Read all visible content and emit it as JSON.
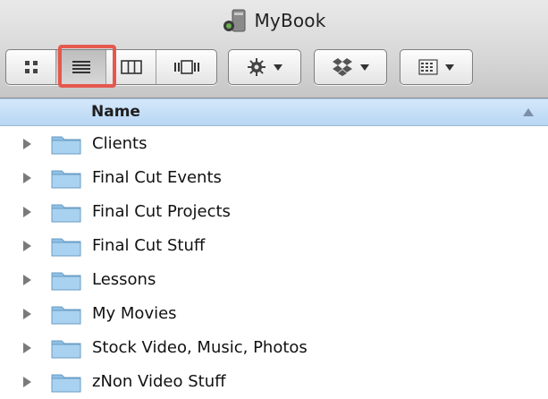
{
  "window": {
    "title": "MyBook",
    "title_icon": "external-drive-icon"
  },
  "toolbar": {
    "view_modes": [
      {
        "name": "icon-view",
        "icon": "grid-icon",
        "selected": false
      },
      {
        "name": "list-view",
        "icon": "list-icon",
        "selected": true
      },
      {
        "name": "column-view",
        "icon": "columns-icon",
        "selected": false
      },
      {
        "name": "cover-flow-view",
        "icon": "cover-flow-icon",
        "selected": false
      }
    ],
    "action_menu": {
      "icon": "gear-icon"
    },
    "dropbox_menu": {
      "icon": "dropbox-icon"
    },
    "arrange_menu": {
      "icon": "arrange-grid-icon"
    },
    "highlight_color": "#e5584e"
  },
  "list": {
    "column_header": "Name",
    "items": [
      {
        "name": "Clients"
      },
      {
        "name": "Final Cut Events"
      },
      {
        "name": "Final Cut Projects"
      },
      {
        "name": "Final Cut Stuff"
      },
      {
        "name": "Lessons"
      },
      {
        "name": "My Movies"
      },
      {
        "name": "Stock Video, Music, Photos"
      },
      {
        "name": "zNon Video Stuff"
      }
    ]
  },
  "colors": {
    "header_blue": "#b8d6f4",
    "folder_blue": "#9fc9ea"
  }
}
